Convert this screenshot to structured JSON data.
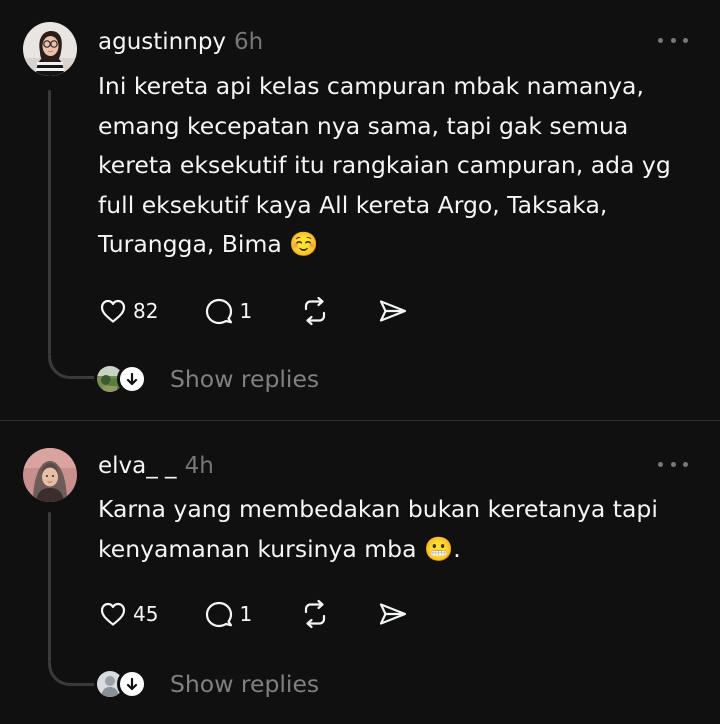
{
  "colors": {
    "background": "#101010",
    "text": "#f3f5f7",
    "muted": "#777777",
    "thread_line": "#3a3a3a"
  },
  "posts": [
    {
      "username": "agustinnpy",
      "time": "6h",
      "body": "Ini kereta api kelas campuran mbak namanya, emang kecepatan nya sama, tapi gak semua kereta eksekutif itu rangkaian campuran, ada yg full eksekutif kaya All kereta Argo, Taksaka, Turangga, Bima ☺️",
      "likes": "82",
      "replies_count": "1",
      "show_replies": "Show replies",
      "icons": [
        "heart-icon",
        "comment-icon",
        "repost-icon",
        "share-icon",
        "more-icon",
        "arrow-down-icon"
      ]
    },
    {
      "username": "elva_ _",
      "time": "4h",
      "body": "Karna yang membedakan bukan keretanya tapi kenyamanan kursinya mba 😬.",
      "likes": "45",
      "replies_count": "1",
      "show_replies": "Show replies",
      "icons": [
        "heart-icon",
        "comment-icon",
        "repost-icon",
        "share-icon",
        "more-icon",
        "arrow-down-icon"
      ]
    }
  ]
}
